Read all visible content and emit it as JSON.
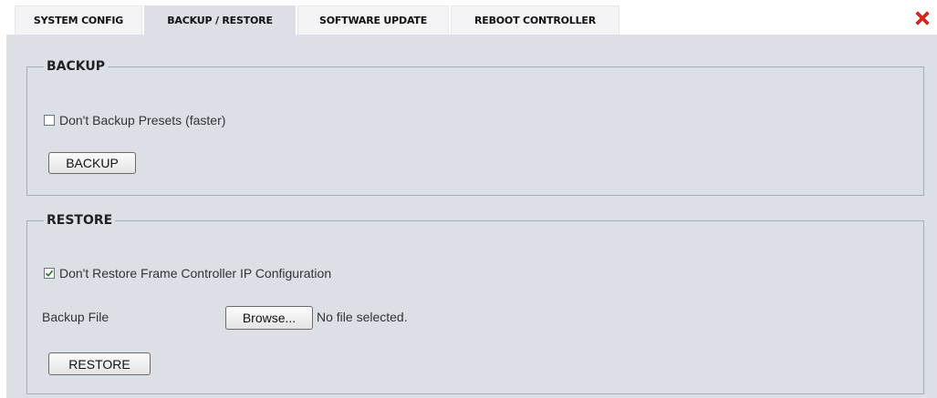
{
  "tabs": [
    {
      "label": "SYSTEM CONFIG",
      "active": false
    },
    {
      "label": "BACKUP / RESTORE",
      "active": true
    },
    {
      "label": "SOFTWARE UPDATE",
      "active": false
    },
    {
      "label": "REBOOT CONTROLLER",
      "active": false
    }
  ],
  "close_icon": "close-icon",
  "colors": {
    "close_red": "#e8261f",
    "panel_bg": "#dcdfe6",
    "check_green": "#2e7d32"
  },
  "backup": {
    "legend": "BACKUP",
    "checkbox_label": "Don't Backup Presets (faster)",
    "checkbox_checked": false,
    "button_label": "BACKUP"
  },
  "restore": {
    "legend": "RESTORE",
    "checkbox_label": "Don't Restore Frame Controller IP Configuration",
    "checkbox_checked": true,
    "file_label": "Backup File",
    "browse_label": "Browse...",
    "file_status": "No file selected.",
    "button_label": "RESTORE"
  }
}
